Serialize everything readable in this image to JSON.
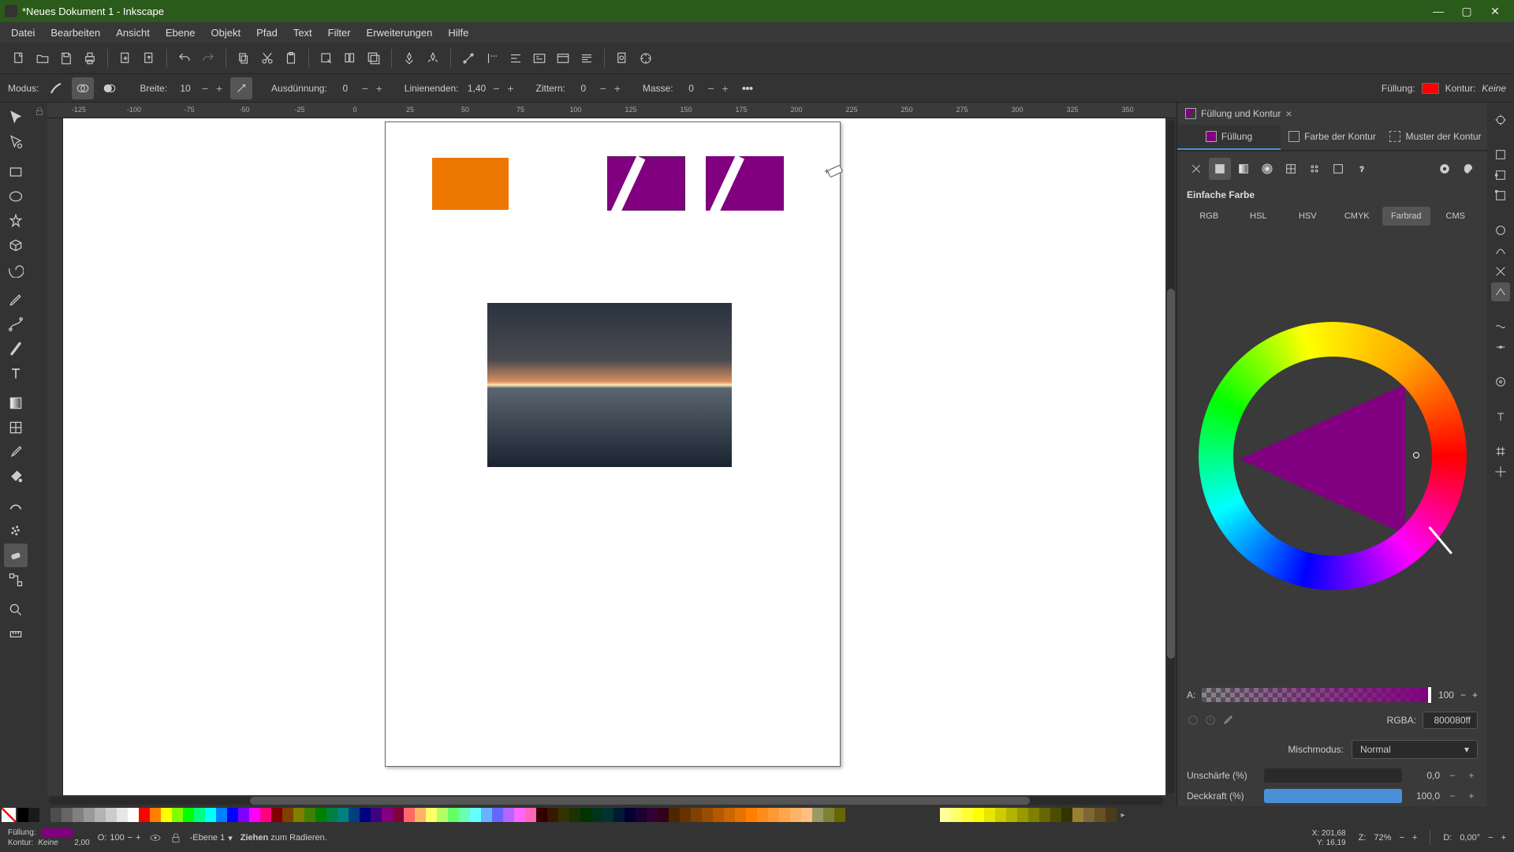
{
  "window": {
    "title": "*Neues Dokument 1 - Inkscape"
  },
  "menu": [
    "Datei",
    "Bearbeiten",
    "Ansicht",
    "Ebene",
    "Objekt",
    "Pfad",
    "Text",
    "Filter",
    "Erweiterungen",
    "Hilfe"
  ],
  "toolbar2": {
    "modus_lbl": "Modus:",
    "breite_lbl": "Breite:",
    "breite_val": "10",
    "ausd_lbl": "Ausdünnung:",
    "ausd_val": "0",
    "le_lbl": "Linienenden:",
    "le_val": "1,40",
    "zit_lbl": "Zittern:",
    "zit_val": "0",
    "masse_lbl": "Masse:",
    "masse_val": "0",
    "fuellung_lbl": "Füllung:",
    "kontur_lbl": "Kontur:",
    "kontur_val": "Keine"
  },
  "hruler": [
    "-125",
    "-100",
    "-75",
    "-50",
    "-25",
    "0",
    "25",
    "50",
    "75",
    "100",
    "125",
    "150",
    "175",
    "200",
    "225",
    "250",
    "275",
    "300",
    "325",
    "350"
  ],
  "panel": {
    "title": "Füllung und Kontur",
    "tab_fill": "Füllung",
    "tab_stroke": "Farbe der Kontur",
    "tab_pattern": "Muster der Kontur",
    "flat_lbl": "Einfache Farbe",
    "ctabs": [
      "RGB",
      "HSL",
      "HSV",
      "CMYK",
      "Farbrad",
      "CMS"
    ],
    "alpha_lbl": "A:",
    "alpha_val": "100",
    "rgba_lbl": "RGBA:",
    "rgba_val": "800080ff",
    "blend_lbl": "Mischmodus:",
    "blend_val": "Normal",
    "blur_lbl": "Unschärfe (%)",
    "blur_val": "0,0",
    "opacity_lbl": "Deckkraft (%)",
    "opacity_val": "100,0"
  },
  "status": {
    "fill_lbl": "Füllung:",
    "stroke_lbl": "Kontur:",
    "stroke_val": "Keine",
    "stroke_w": "2,00",
    "o_lbl": "O:",
    "o_val": "100",
    "layer": "-Ebene 1",
    "hint_a": "Ziehen",
    "hint_b": " zum Radieren.",
    "x_lbl": "X:",
    "x_val": "201,68",
    "y_lbl": "Y:",
    "y_val": "16,19",
    "z_lbl": "Z:",
    "z_val": "72%",
    "d_lbl": "D:",
    "d_val": "0,00°"
  },
  "palette_main": [
    "#000",
    "#1a1a1a",
    "#333",
    "#4d4d4d",
    "#666",
    "#808080",
    "#999",
    "#b3b3b3",
    "#ccc",
    "#e6e6e6",
    "#fff",
    "#f00",
    "#ff8000",
    "#ff0",
    "#80ff00",
    "#0f0",
    "#00ff80",
    "#0ff",
    "#0080ff",
    "#00f",
    "#8000ff",
    "#f0f",
    "#ff0080",
    "#800000",
    "#804000",
    "#808000",
    "#408000",
    "#008000",
    "#008040",
    "#008080",
    "#004080",
    "#000080",
    "#400080",
    "#800080",
    "#800040",
    "#ff6666",
    "#ffb366",
    "#ffff66",
    "#b3ff66",
    "#66ff66",
    "#66ffb3",
    "#66ffff",
    "#66b3ff",
    "#6666ff",
    "#b366ff",
    "#ff66ff",
    "#ff66b3",
    "#330000",
    "#331a00",
    "#333300",
    "#1a3300",
    "#003300",
    "#00331a",
    "#003333",
    "#001a33",
    "#000033",
    "#1a0033",
    "#330033",
    "#33001a",
    "#4d2600",
    "#663300",
    "#804000",
    "#994d00",
    "#b35900",
    "#cc6600",
    "#e67300",
    "#ff8000",
    "#ff8c1a",
    "#ff9933",
    "#ffa64d",
    "#ffb366",
    "#ffbf80",
    "#999966",
    "#808033",
    "#666600"
  ],
  "palette_right": [
    "#ffff99",
    "#ffff66",
    "#ffff33",
    "#ffff00",
    "#e6e600",
    "#cccc00",
    "#b3b300",
    "#999900",
    "#808000",
    "#666600",
    "#4d4d00",
    "#333300",
    "#998033",
    "#806633",
    "#665026",
    "#4d3a1a"
  ]
}
